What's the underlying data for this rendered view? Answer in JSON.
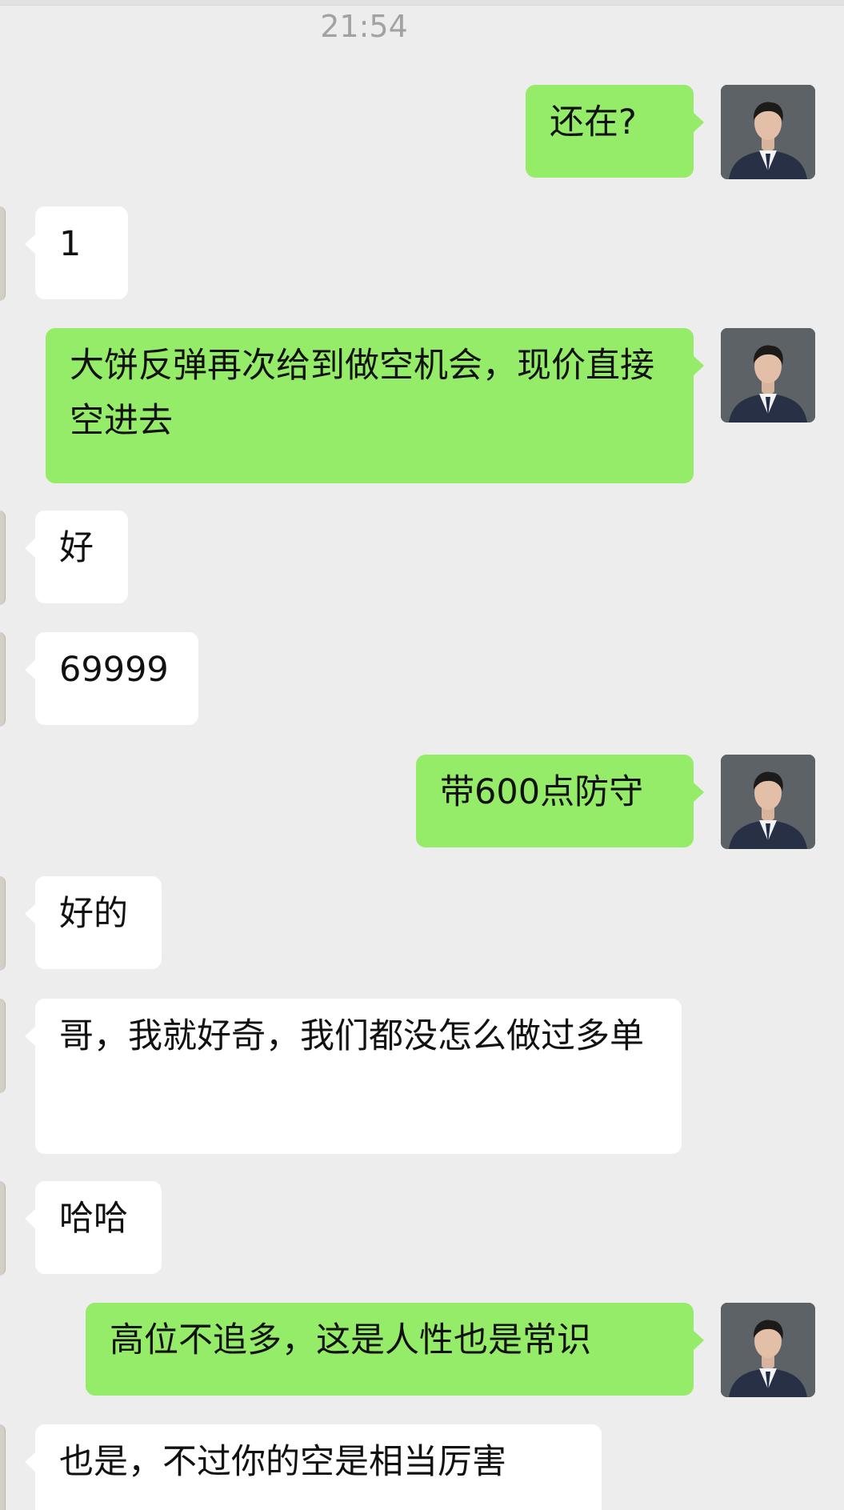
{
  "chat": {
    "timestamp": "21:54",
    "messages": [
      {
        "side": "out",
        "text": "还在?"
      },
      {
        "side": "in",
        "text": "1"
      },
      {
        "side": "out",
        "text": "大饼反弹再次给到做空机会，现价直接空进去"
      },
      {
        "side": "in",
        "text": "好"
      },
      {
        "side": "in",
        "text": "69999"
      },
      {
        "side": "out",
        "text": "带600点防守"
      },
      {
        "side": "in",
        "text": "好的"
      },
      {
        "side": "in",
        "text": "哥，我就好奇，我们都没怎么做过多单"
      },
      {
        "side": "in",
        "text": "哈哈"
      },
      {
        "side": "out",
        "text": "高位不追多，这是人性也是常识"
      },
      {
        "side": "in",
        "text": "也是，不过你的空是相当厉害"
      }
    ]
  },
  "colors": {
    "background": "#ededed",
    "outgoing_bubble": "#95ec69",
    "incoming_bubble": "#ffffff",
    "timestamp_text": "#a2a2a2"
  },
  "icons": {
    "own_avatar": "user-avatar-icon",
    "peer_avatar": "contact-avatar-icon"
  }
}
